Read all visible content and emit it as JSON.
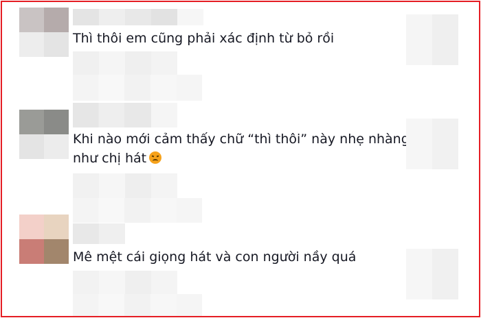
{
  "comments": [
    {
      "text": "Thì thôi em cũng phải xác định từ bỏ rồi"
    },
    {
      "line1": "Khi nào mới cảm thấy chữ “thì thôi” này nhẹ nhàng",
      "line2": "như chị hát",
      "emoji": "disappointed-face-icon"
    },
    {
      "text": "Mê mệt cái giọng hát và con người nầy quá"
    }
  ],
  "colors": {
    "frame_border": "#e51c23",
    "text": "#161823",
    "emoji": "#f6a21b"
  }
}
